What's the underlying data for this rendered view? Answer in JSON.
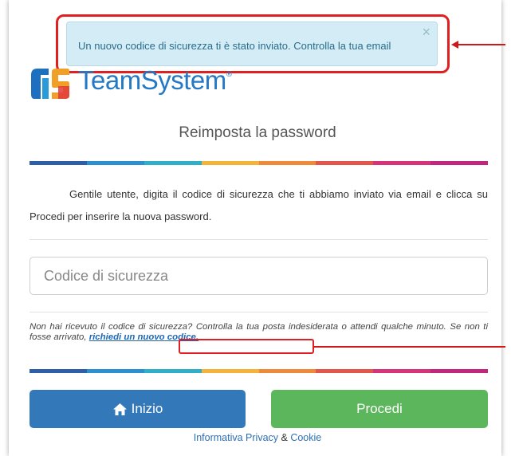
{
  "alert": {
    "message": "Un nuovo codice di sicurezza ti è stato inviato. Controlla la tua email",
    "close_glyph": "×"
  },
  "brand": {
    "name": "TeamSystem",
    "reg": "®"
  },
  "page": {
    "title": "Reimposta la password"
  },
  "instructions": "Gentile utente, digita il codice di sicurezza che ti abbiamo inviato via email e clicca su Procedi per inserire la nuova password.",
  "code_field": {
    "placeholder": "Codice di sicurezza",
    "value": ""
  },
  "resend_note": {
    "text": "Non hai ricevuto il codice di sicurezza? Controlla la tua posta indesiderata o attendi qualche minuto. Se non ti fosse arrivato, ",
    "link": "richiedi un nuovo codice."
  },
  "buttons": {
    "home": "Inizio",
    "home_icon": "home-icon",
    "proceed": "Procedi"
  },
  "footer": {
    "privacy": "Informativa Privacy",
    "and": " & ",
    "cookie": "Cookie"
  },
  "colors": {
    "stripe": [
      "#2f5ea8",
      "#2c8fcf",
      "#2fb0c8",
      "#f4b43a",
      "#ef8a3a",
      "#e2564c",
      "#d6337a",
      "#c2277f"
    ],
    "home_button": "#3378b8",
    "proceed_button": "#5cb75c",
    "highlight": "#e02020"
  }
}
